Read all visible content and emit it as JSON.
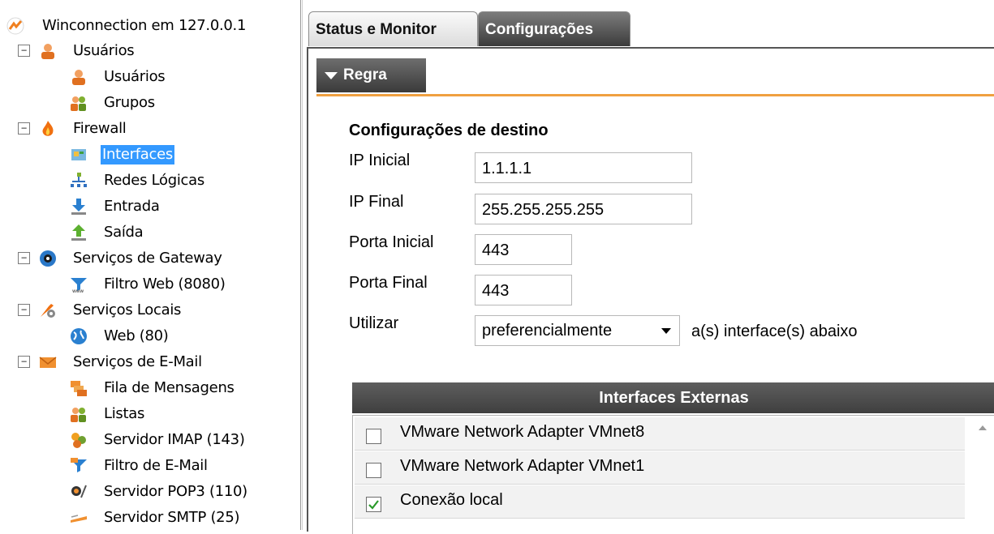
{
  "tree": {
    "root": "Winconnection em 127.0.0.1",
    "items": [
      {
        "label": "Usuários",
        "icon": "user-icon",
        "expander": "−"
      },
      {
        "label": "Usuários",
        "icon": "user-icon"
      },
      {
        "label": "Grupos",
        "icon": "group-icon"
      },
      {
        "label": "Firewall",
        "icon": "fire-icon",
        "expander": "−"
      },
      {
        "label": "Interfaces",
        "icon": "network-card-icon"
      },
      {
        "label": "Redes Lógicas",
        "icon": "network-tree-icon"
      },
      {
        "label": "Entrada",
        "icon": "download-arrow-icon"
      },
      {
        "label": "Saída",
        "icon": "upload-arrow-icon"
      },
      {
        "label": "Serviços de Gateway",
        "icon": "globe-gateway-icon",
        "expander": "−"
      },
      {
        "label": "Filtro Web (8080)",
        "icon": "funnel-www-icon"
      },
      {
        "label": "Serviços Locais",
        "icon": "tools-icon",
        "expander": "−"
      },
      {
        "label": "Web (80)",
        "icon": "globe-icon"
      },
      {
        "label": "Serviços de E-Mail",
        "icon": "envelope-icon",
        "expander": "−"
      },
      {
        "label": "Fila de Mensagens",
        "icon": "message-queue-icon"
      },
      {
        "label": "Listas",
        "icon": "group-icon"
      },
      {
        "label": "Servidor IMAP (143)",
        "icon": "imap-server-icon"
      },
      {
        "label": "Filtro de E-Mail",
        "icon": "mail-filter-icon"
      },
      {
        "label": "Servidor POP3 (110)",
        "icon": "pop3-server-icon"
      },
      {
        "label": "Servidor SMTP (25)",
        "icon": "smtp-server-icon"
      }
    ],
    "selected": "Interfaces"
  },
  "tabs": [
    "Status e Monitor",
    "Configurações"
  ],
  "active_tab": "Configurações",
  "section": {
    "label": "Regra"
  },
  "form": {
    "title": "Configurações de destino",
    "ip_inicial_label": "IP Inicial",
    "ip_inicial": "1.1.1.1",
    "ip_final_label": "IP Final",
    "ip_final": "255.255.255.255",
    "porta_inicial_label": "Porta Inicial",
    "porta_inicial": "443",
    "porta_final_label": "Porta Final",
    "porta_final": "443",
    "utilizar_label": "Utilizar",
    "utilizar_value": "preferencialmente",
    "utilizar_suffix": "a(s) interface(s) abaixo"
  },
  "interfaces": {
    "title": "Interfaces Externas",
    "rows": [
      {
        "name": "VMware Network Adapter VMnet8",
        "checked": false
      },
      {
        "name": "VMware Network Adapter VMnet1",
        "checked": false
      },
      {
        "name": "Conexão local",
        "checked": true
      }
    ]
  },
  "colors": {
    "accent_orange": "#f0a040",
    "selection_blue": "#3399ff",
    "dark_header": "#3f3f3f"
  }
}
